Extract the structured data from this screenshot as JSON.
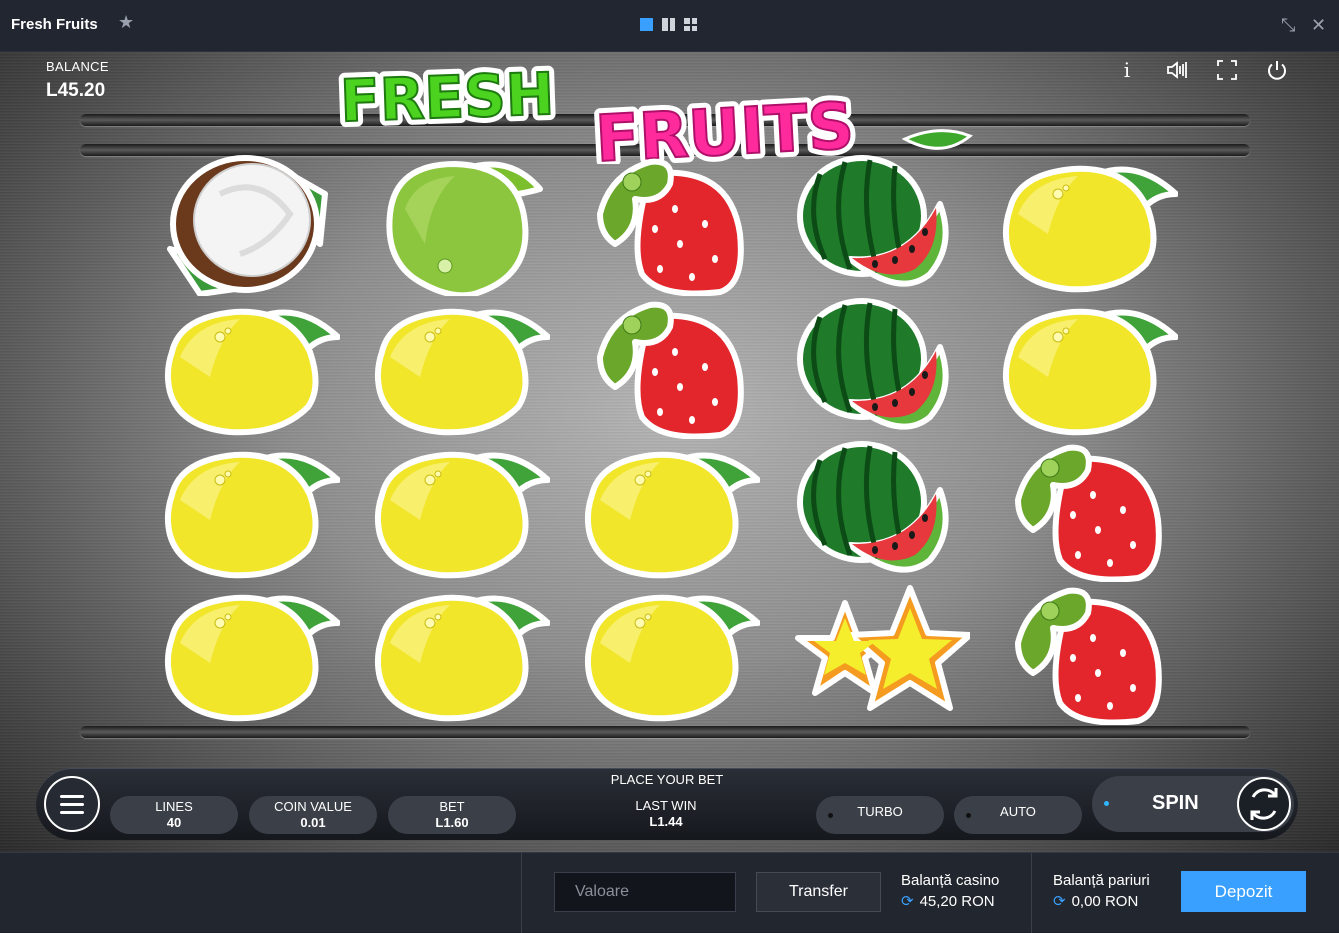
{
  "window": {
    "title": "Fresh Fruits",
    "star_icon": "star-icon",
    "view_icons": [
      "single-view-icon",
      "split-view-icon",
      "grid-view-icon"
    ],
    "controls": [
      "minimize-icon",
      "close-icon"
    ]
  },
  "game": {
    "balance_label": "BALANCE",
    "balance_value": "L45.20",
    "logo": {
      "word1": "FRESH",
      "word2": "FRUITS"
    },
    "top_icons": [
      "info-icon",
      "sound-icon",
      "fullscreen-icon",
      "power-icon"
    ],
    "reels": [
      [
        "coconut",
        "lemon",
        "lemon",
        "lemon"
      ],
      [
        "lime",
        "lemon",
        "lemon",
        "lemon"
      ],
      [
        "strawberry",
        "strawberry",
        "lemon",
        "lemon"
      ],
      [
        "watermelon",
        "watermelon",
        "watermelon",
        "star"
      ],
      [
        "lemon",
        "lemon",
        "strawberry",
        "strawberry"
      ]
    ]
  },
  "controls": {
    "place_bet": "PLACE YOUR BET",
    "lines_label": "LINES",
    "lines_value": "40",
    "coin_label": "COIN VALUE",
    "coin_value": "0.01",
    "bet_label": "BET",
    "bet_value": "L1.60",
    "last_win_label": "LAST WIN",
    "last_win_value": "L1.44",
    "turbo_label": "TURBO",
    "auto_label": "AUTO",
    "spin_label": "SPIN"
  },
  "footer": {
    "amount_placeholder": "Valoare",
    "transfer_label": "Transfer",
    "casino_label": "Balanță casino",
    "casino_value": "45,20 RON",
    "bets_label": "Balanță pariuri",
    "bets_value": "0,00 RON",
    "deposit_label": "Depozit"
  },
  "colors": {
    "accent": "#3aa0ff",
    "logo_green": "#4cd31f",
    "logo_pink": "#ff2a9c"
  }
}
